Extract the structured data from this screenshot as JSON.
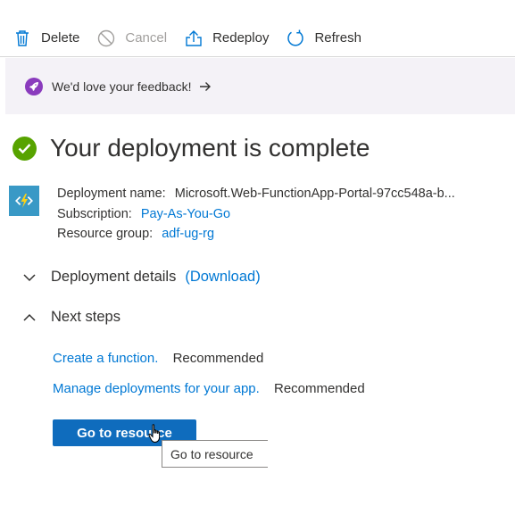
{
  "toolbar": {
    "delete_label": "Delete",
    "cancel_label": "Cancel",
    "redeploy_label": "Redeploy",
    "refresh_label": "Refresh"
  },
  "feedback": {
    "text": "We'd love your feedback!",
    "arrow": "→"
  },
  "page_title": "Your deployment is complete",
  "deployment": {
    "name_label": "Deployment name:",
    "name_value": "Microsoft.Web-FunctionApp-Portal-97cc548a-b...",
    "subscription_label": "Subscription:",
    "subscription_value": "Pay-As-You-Go",
    "resource_group_label": "Resource group:",
    "resource_group_value": "adf-ug-rg"
  },
  "sections": {
    "details_label": "Deployment details",
    "download_link": "(Download)",
    "next_steps_label": "Next steps"
  },
  "next_steps": [
    {
      "link": "Create a function.",
      "tag": "Recommended"
    },
    {
      "link": "Manage deployments for your app.",
      "tag": "Recommended"
    }
  ],
  "go_button_label": "Go to resource",
  "tooltip_text": "Go to resource",
  "colors": {
    "accent": "#0078d4",
    "primary_button": "#0f6cbd",
    "success": "#57a300",
    "feedback_bg": "#f4f2f7",
    "rocket": "#8a3bbd",
    "function_app": "#3999c6"
  }
}
